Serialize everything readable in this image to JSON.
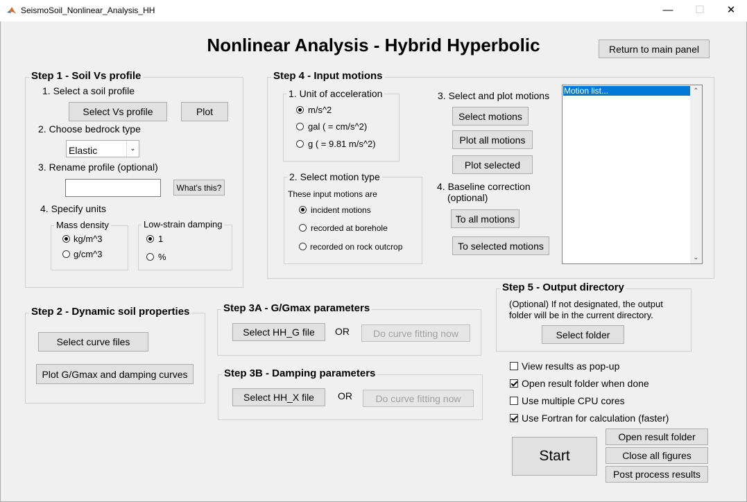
{
  "window": {
    "title": "SeismoSoil_Nonlinear_Analysis_HH",
    "minimize": "—",
    "maximize": "☐",
    "close": "✕"
  },
  "header": {
    "title": "Nonlinear Analysis - Hybrid Hyperbolic",
    "return_button": "Return to main panel"
  },
  "step1": {
    "title": "Step 1 - Soil Vs profile",
    "select_profile_label": "1. Select a soil profile",
    "select_vs_button": "Select Vs profile",
    "plot_button": "Plot",
    "bedrock_label": "2. Choose bedrock type",
    "bedrock_value": "Elastic",
    "rename_label": "3. Rename profile (optional)",
    "rename_value": "",
    "whats_this_button": "What's this?",
    "units_label": "4. Specify units",
    "mass_density": {
      "title": "Mass density",
      "options": [
        "kg/m^3",
        "g/cm^3"
      ],
      "selected": 0
    },
    "damping": {
      "title": "Low-strain damping",
      "options": [
        "1",
        "%"
      ],
      "selected": 0
    }
  },
  "step2": {
    "title": "Step 2 - Dynamic soil properties",
    "select_curve_button": "Select curve files",
    "plot_curves_button": "Plot G/Gmax and damping curves"
  },
  "step3a": {
    "title": "Step 3A - G/Gmax parameters",
    "select_button": "Select HH_G file",
    "or": "OR",
    "fit_button": "Do curve fitting now"
  },
  "step3b": {
    "title": "Step 3B - Damping parameters",
    "select_button": "Select HH_X file",
    "or": "OR",
    "fit_button": "Do curve fitting now"
  },
  "step4": {
    "title": "Step 4 - Input motions",
    "unit": {
      "title": "1. Unit of acceleration",
      "options": [
        "m/s^2",
        "gal ( = cm/s^2)",
        "g ( = 9.81 m/s^2)"
      ],
      "selected": 0
    },
    "motion_type": {
      "title": "2. Select motion type",
      "intro": "These input motions are",
      "options": [
        "incident motions",
        "recorded at borehole",
        "recorded on rock outcrop"
      ],
      "selected": 0
    },
    "select_plot_label": "3. Select and plot motions",
    "select_motions_button": "Select motions",
    "plot_all_button": "Plot all motions",
    "plot_selected_button": "Plot selected",
    "baseline_label_1": "4. Baseline correction",
    "baseline_label_2": "(optional)",
    "to_all_button": "To all motions",
    "to_selected_button": "To selected motions",
    "motion_list": [
      "Motion list..."
    ]
  },
  "step5": {
    "title": "Step 5 - Output directory",
    "desc_1": "(Optional) If not designated, the output",
    "desc_2": "folder will be in the current directory.",
    "select_folder_button": "Select folder"
  },
  "options": [
    {
      "label": "View results as pop-up",
      "checked": false
    },
    {
      "label": "Open result folder when done",
      "checked": true
    },
    {
      "label": "Use multiple CPU cores",
      "checked": false
    },
    {
      "label": "Use Fortran for calculation (faster)",
      "checked": true
    }
  ],
  "actions": {
    "start": "Start",
    "open_result_folder": "Open result folder",
    "close_all_figures": "Close all figures",
    "post_process": "Post process results"
  }
}
